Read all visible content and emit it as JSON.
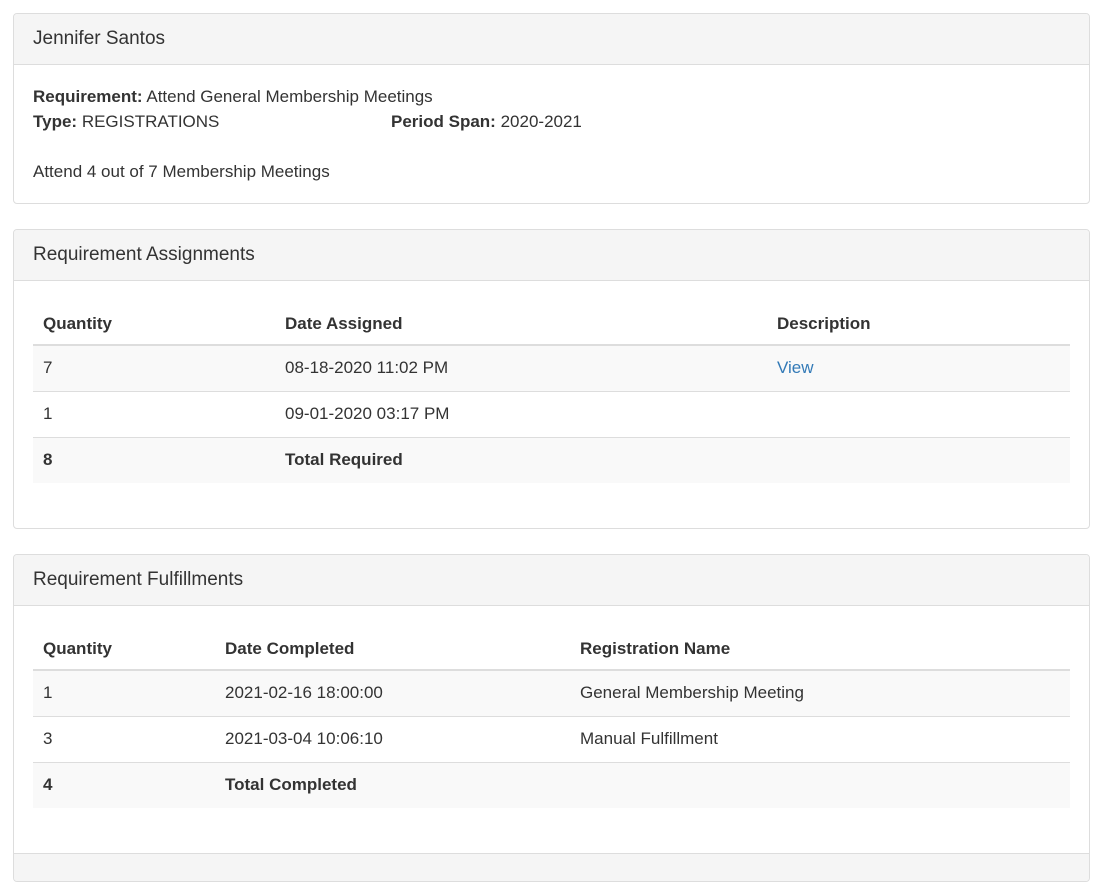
{
  "member": {
    "name": "Jennifer Santos",
    "requirement_label": "Requirement:",
    "requirement_value": "Attend General Membership Meetings",
    "type_label": "Type:",
    "type_value": "REGISTRATIONS",
    "period_label": "Period Span:",
    "period_value": "2020-2021",
    "description": "Attend 4 out of 7 Membership Meetings"
  },
  "assignments": {
    "title": "Requirement Assignments",
    "columns": [
      "Quantity",
      "Date Assigned",
      "Description"
    ],
    "rows": [
      {
        "quantity": "7",
        "date": "08-18-2020 11:02 PM",
        "description": "View"
      },
      {
        "quantity": "1",
        "date": "09-01-2020 03:17 PM",
        "description": ""
      }
    ],
    "total": {
      "quantity": "8",
      "label": "Total Required"
    }
  },
  "fulfillments": {
    "title": "Requirement Fulfillments",
    "columns": [
      "Quantity",
      "Date Completed",
      "Registration Name"
    ],
    "rows": [
      {
        "quantity": "1",
        "date": "2021-02-16 18:00:00",
        "name": "General Membership Meeting"
      },
      {
        "quantity": "3",
        "date": "2021-03-04 10:06:10",
        "name": "Manual Fulfillment"
      }
    ],
    "total": {
      "quantity": "4",
      "label": "Total Completed"
    }
  },
  "colors": {
    "link": "#337ab7",
    "panel_heading_bg": "#f5f5f5",
    "border": "#dddddd",
    "stripe": "#f9f9f9"
  }
}
